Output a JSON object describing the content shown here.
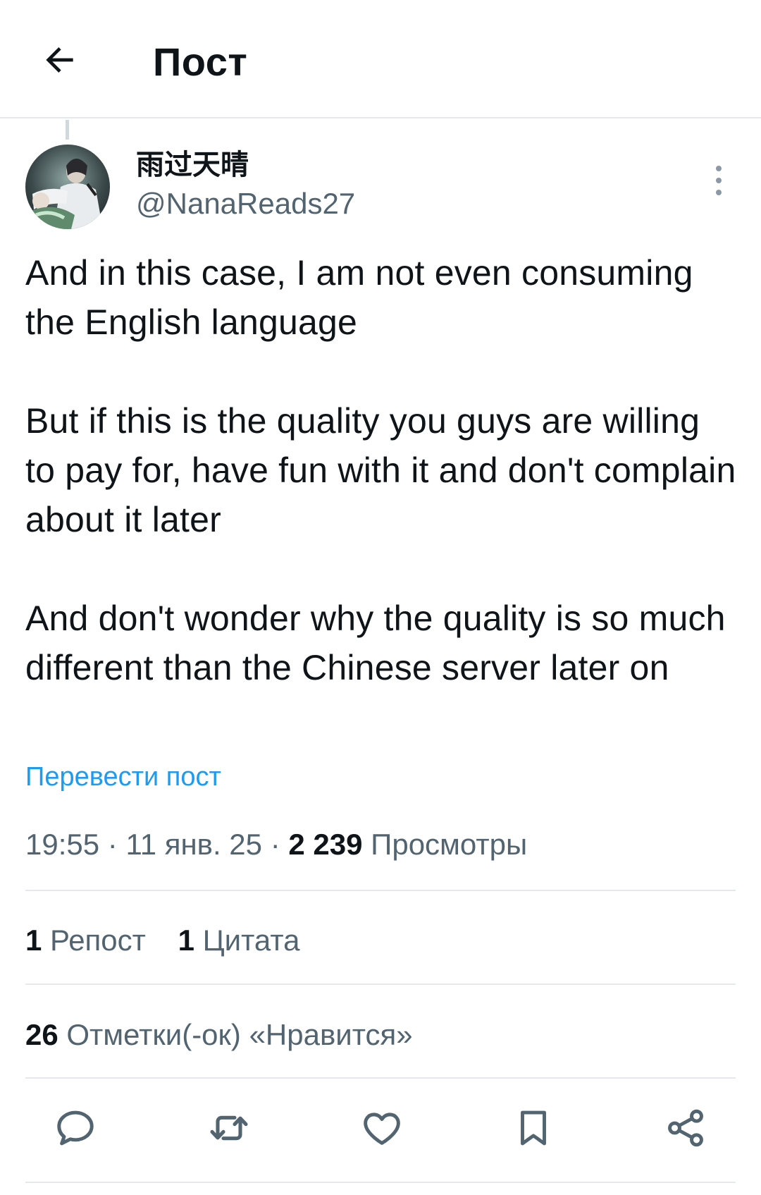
{
  "header": {
    "title": "Пост",
    "back_icon": "arrow-left-icon"
  },
  "author": {
    "display_name": "雨过天晴",
    "handle": "@NanaReads27",
    "avatar": "avatar-image"
  },
  "post": {
    "paragraphs": [
      "And in this case, I am not even consuming the English language",
      "But if this is the quality you guys are willing to pay for, have fun with it and don't complain about it later",
      "And don't wonder why the quality is so much different than the Chinese server later on"
    ],
    "translate_label": "Перевести пост"
  },
  "meta": {
    "time": "19:55",
    "separator": "·",
    "date": "11 янв. 25",
    "views_count": "2 239",
    "views_label": "Просмотры"
  },
  "stats": {
    "reposts_count": "1",
    "reposts_label": "Репост",
    "quotes_count": "1",
    "quotes_label": "Цитата",
    "likes_count": "26",
    "likes_label": "Отметки(-ок) «Нравится»"
  },
  "actions": [
    {
      "name": "reply",
      "icon": "comment-icon"
    },
    {
      "name": "repost",
      "icon": "repost-icon"
    },
    {
      "name": "like",
      "icon": "heart-icon"
    },
    {
      "name": "bookmark",
      "icon": "bookmark-icon"
    },
    {
      "name": "share",
      "icon": "share-icon"
    }
  ],
  "colors": {
    "text_primary": "#0f1419",
    "text_secondary": "#536471",
    "link": "#1d9bf0",
    "divider": "#e6e9eb"
  }
}
